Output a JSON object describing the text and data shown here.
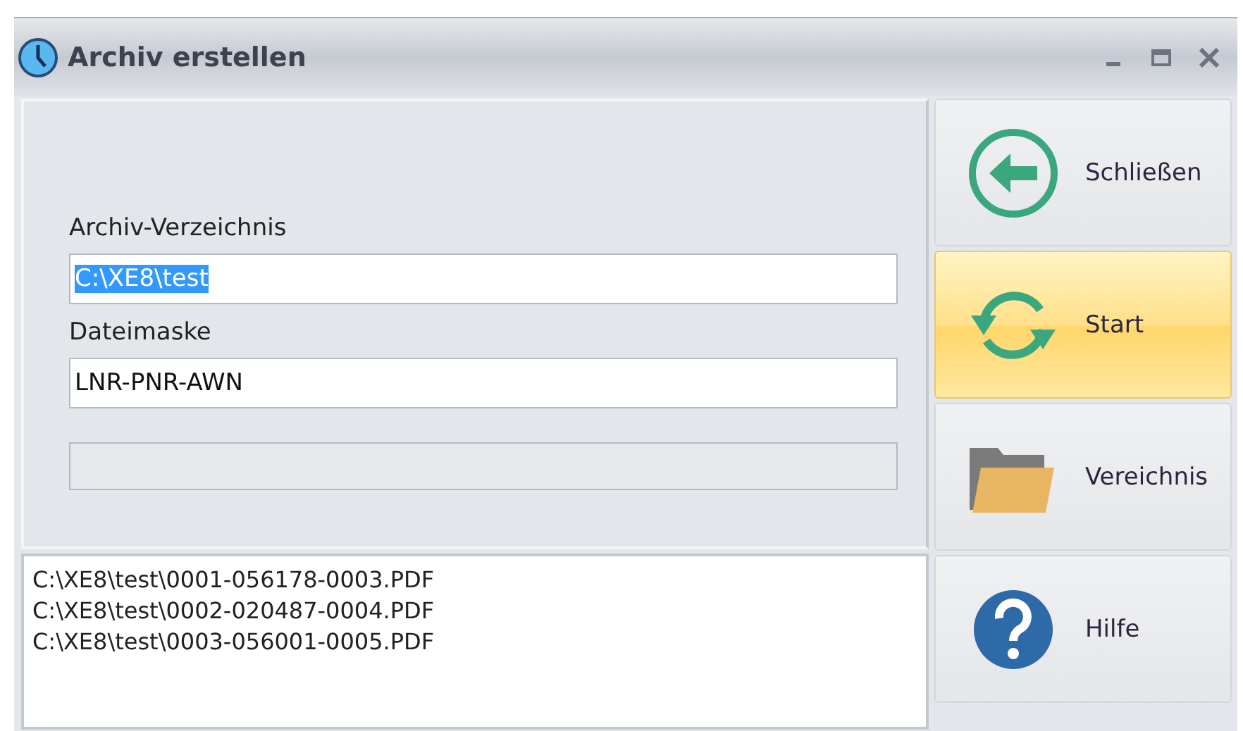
{
  "window": {
    "title": "Archiv erstellen"
  },
  "form": {
    "fields": [
      {
        "label": "Archiv-Verzeichnis",
        "value": "C:\\XE8\\test",
        "selected": true
      },
      {
        "label": "Dateimaske",
        "value": "LNR-PNR-AWN",
        "selected": false
      }
    ],
    "progress": {
      "level": 0
    }
  },
  "log": [
    "C:\\XE8\\test\\0001-056178-0003.PDF",
    "C:\\XE8\\test\\0002-020487-0004.PDF",
    "C:\\XE8\\test\\0003-056001-0005.PDF"
  ],
  "buttons": [
    {
      "kind": "back",
      "label": "Schließen",
      "highlighted": false
    },
    {
      "kind": "refresh",
      "label": "Start",
      "highlighted": true
    },
    {
      "kind": "folder",
      "label": "Vereichnis",
      "highlighted": false
    },
    {
      "kind": "help",
      "label": "Hilfe",
      "highlighted": false
    }
  ]
}
